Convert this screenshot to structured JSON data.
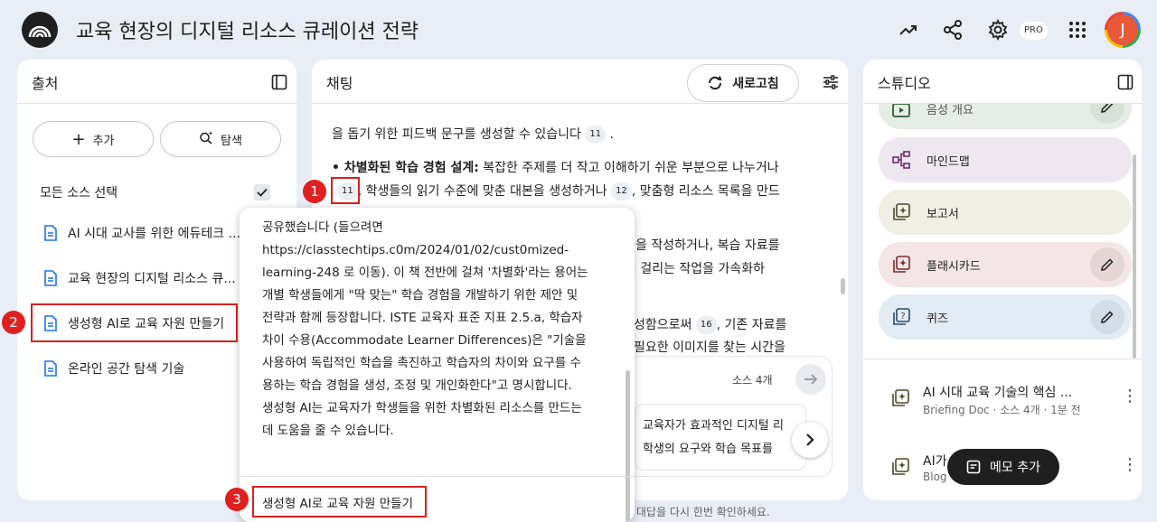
{
  "app": {
    "title": "교육 현장의 디지털 리소스 큐레이션 전략",
    "pro_badge": "PRO",
    "avatar_letter": "J"
  },
  "sources": {
    "title": "출처",
    "add_label": "추가",
    "explore_label": "탐색",
    "select_all_label": "모든 소스 선택",
    "items": [
      "AI 시대 교사를 위한 에듀테크 ...",
      "교육 현장의 디지털 리소스 큐...",
      "생성형 AI로 교육 자원 만들기",
      "온라인 공간 탐색 기술"
    ]
  },
  "chat": {
    "title": "채팅",
    "refresh_label": "새로고침",
    "line1_text": "을 돕기 위한 피드백 문구를 생성할 수 있습니다",
    "line1_cite": "11",
    "line2_bold": "• 차별화된 학습 경험 설계:",
    "line2_text": " 복잡한 주제를 더 작고 이해하기 쉬운 부분으로 나누거나",
    "line3_cite_a": "11",
    "line3_text": ", 학생들의 읽기 수준에 맞춘 대본을 생성하거나",
    "line3_cite_b": "12",
    "line3_text_b": ", 맞춤형 리소스 목록을 만드",
    "partial1": "을 작성하거나, 복습 자료를",
    "partial2": "이 걸리는 작업을 가속화하",
    "partial3_cite": "16",
    "partial3_pre": "성함으로써",
    "partial3": ", 기존 자료를",
    "partial4": "필요한 이미지를 찾는 시간을",
    "source_count": "소스 4개",
    "card_line1": "교육자가 효과적인 디지털 리",
    "card_line2": "학생의 요구와 학습 목표를",
    "footer_note": "대답을 다시 한번 확인하세요."
  },
  "popup": {
    "lines": [
      "공유했습니다 (들으려면",
      "https://classtechtips.c0m/2024/01/02/cust0mized-",
      "learning-248 로 이동). 이 책 전반에 걸쳐 '차별화'라는 용어는",
      "개별 학생들에게 \"딱 맞는\" 학습 경험을 개발하기 위한 제안 및",
      "전략과 함께 등장합니다. ISTE 교육자 표준 지표 2.5.a, 학습자",
      "차이 수용(Accommodate Learner Differences)은 \"기술을",
      "사용하여 독립적인 학습을 촉진하고 학습자의 차이와 요구를 수",
      "용하는 학습 경험을 생성, 조정 및 개인화한다\"고 명시합니다.",
      "생성형 AI는 교육자가 학생들을 위한 차별화된 리소스를 만드는",
      "데 도움을 줄 수 있습니다."
    ],
    "source_title": "생성형 AI로 교육 자원 만들기"
  },
  "studio": {
    "title": "스튜디오",
    "tiles": [
      {
        "label": "음성 개요",
        "color": "#e6ece6"
      },
      {
        "label": "마인드맵",
        "color": "#efe7f0"
      },
      {
        "label": "보고서",
        "color": "#efefe6"
      },
      {
        "label": "플래시카드",
        "color": "#f4e6e6"
      },
      {
        "label": "퀴즈",
        "color": "#e3ecf4"
      }
    ],
    "notes": [
      {
        "title": "AI 시대 교육 기술의 핵심 ...",
        "sub": "Briefing Doc · 소스 4개 · 1분 전"
      },
      {
        "title": "AI가",
        "sub": "Blog"
      }
    ],
    "memo_add_label": "메모 추가"
  },
  "annotations": [
    "1",
    "2",
    "3"
  ]
}
